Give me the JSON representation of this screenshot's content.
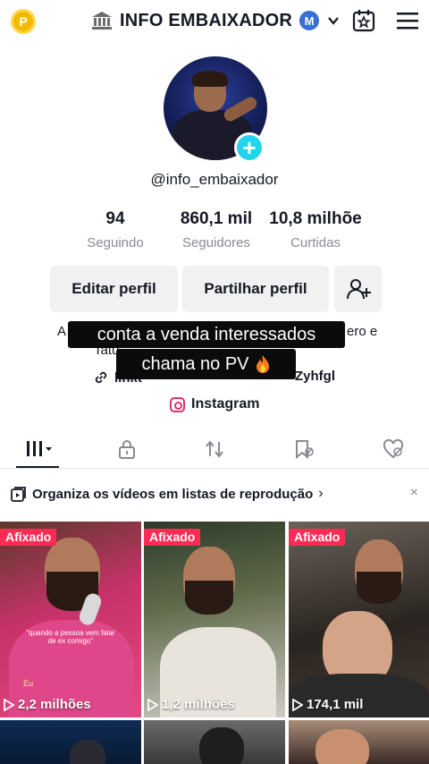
{
  "header": {
    "coin_label": "P",
    "title": "INFO EMBAIXADOR",
    "badge_label": "M"
  },
  "profile": {
    "username": "@info_embaixador",
    "stats": [
      {
        "value": "94",
        "label": "Seguindo"
      },
      {
        "value": "860,1 mil",
        "label": "Seguidores"
      },
      {
        "value": "10,8 milhõe",
        "label": "Curtidas"
      }
    ],
    "buttons": {
      "edit": "Editar perfil",
      "share": "Partilhar perfil"
    },
    "bio_left": "A",
    "bio_right": "ero e",
    "bio_line2": "Tatu",
    "link_text": "linkt",
    "link_tail": "Zyhfgl",
    "instagram_label": "Instagram"
  },
  "overlay": {
    "line1": "conta a venda interessados",
    "line2": "chama no PV"
  },
  "playlist_banner": {
    "text": "Organiza os vídeos em listas de reprodução",
    "chevron": "›",
    "close": "×"
  },
  "videos": [
    {
      "pinned": "Afixado",
      "views": "2,2 milhões",
      "caption": "\"quando a pessoa vem falar de ex comigo\"",
      "caption_small": "Eu"
    },
    {
      "pinned": "Afixado",
      "views": "1,2 milhões"
    },
    {
      "pinned": "Afixado",
      "views": "174,1 mil"
    }
  ],
  "colors": {
    "accent_pink": "#fe2c55",
    "accent_cyan": "#20d5ec",
    "text_primary": "#161823",
    "text_secondary": "#8a8b91",
    "button_bg": "#f1f1f2"
  },
  "icons": {
    "coin": "coin-icon",
    "bank": "bank-icon",
    "calendar": "calendar-star-icon",
    "menu": "hamburger-menu-icon",
    "add_friend": "add-user-icon",
    "link": "link-icon",
    "instagram": "instagram-icon",
    "tab_videos": "grid-icon",
    "tab_private": "lock-icon",
    "tab_reposts": "repost-icon",
    "tab_saved": "bookmark-icon",
    "tab_liked": "heart-icon",
    "playlist": "playlist-icon",
    "play": "play-icon"
  }
}
